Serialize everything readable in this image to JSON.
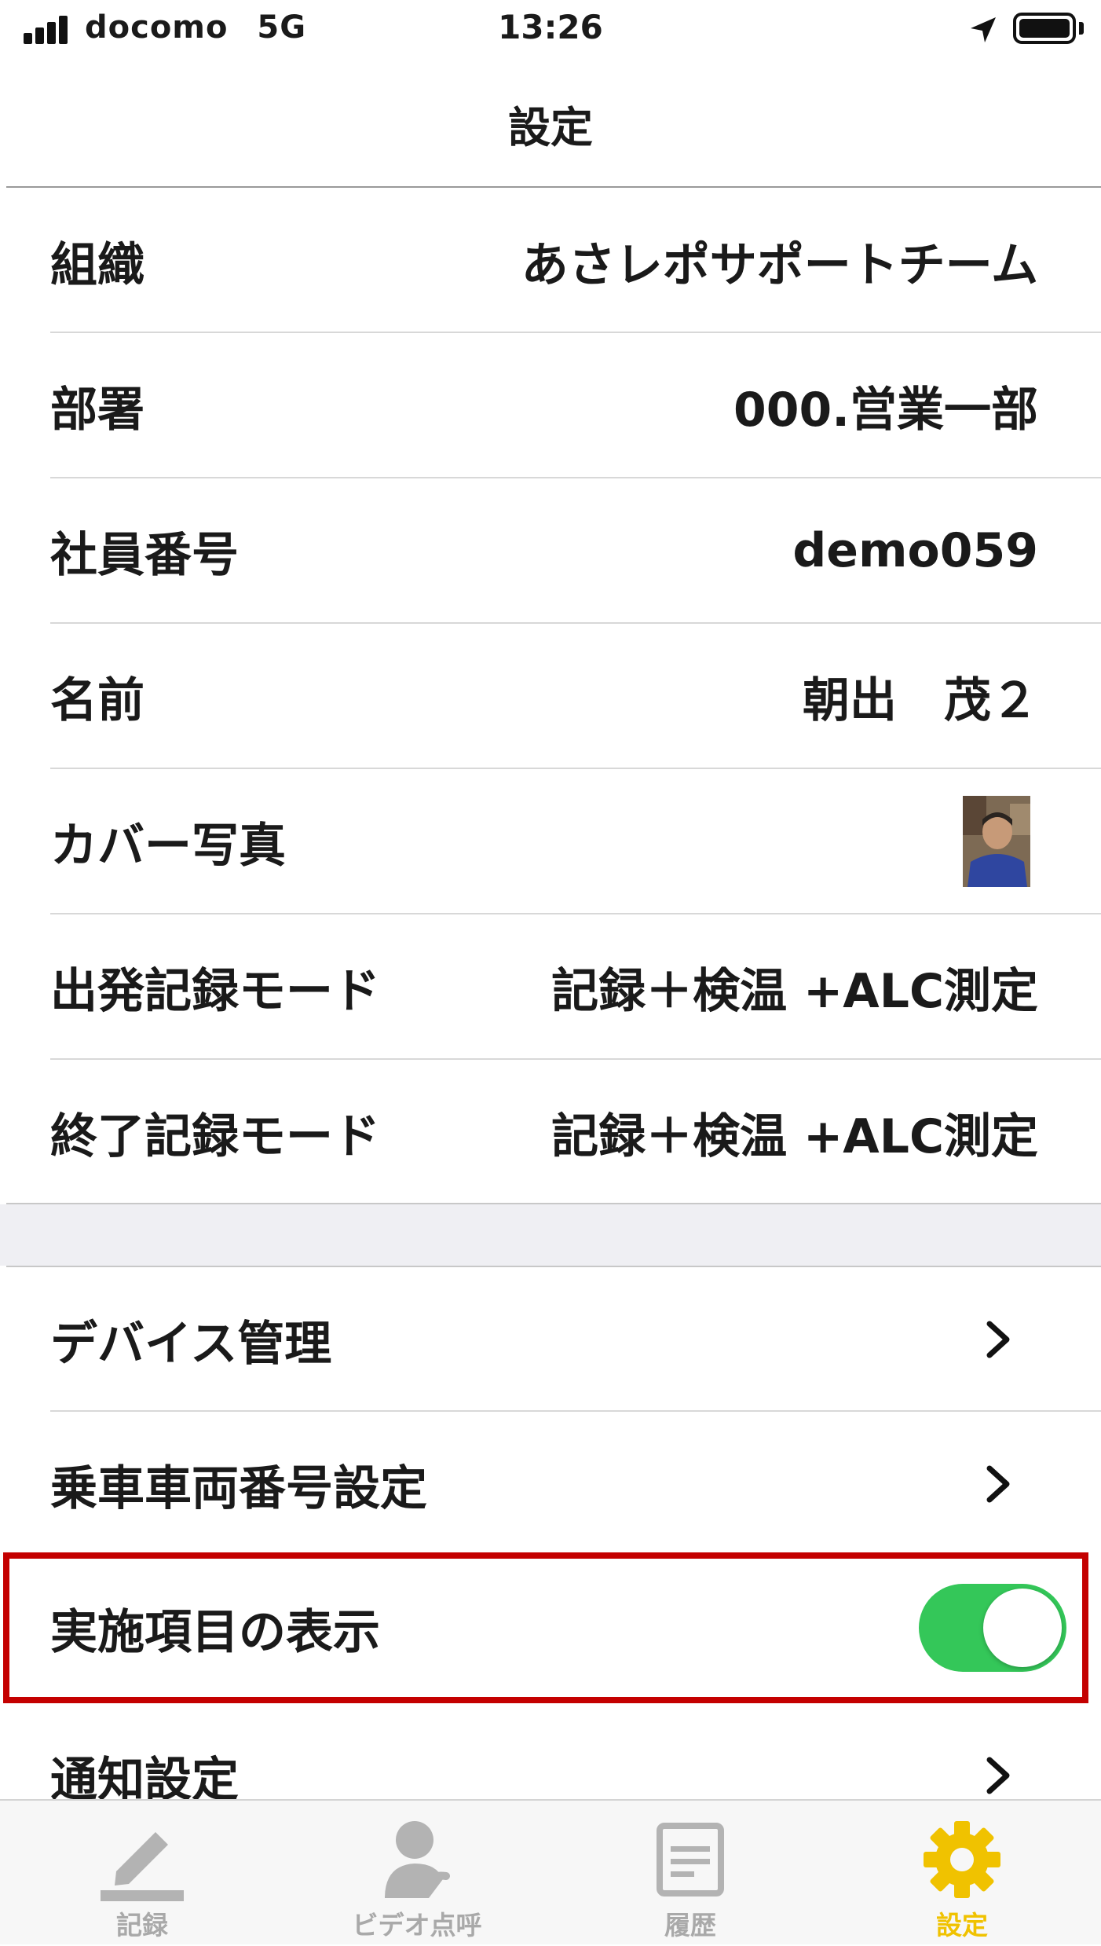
{
  "status_bar": {
    "carrier": "docomo",
    "network": "5G",
    "time": "13:26"
  },
  "nav": {
    "title": "設定"
  },
  "rows": [
    {
      "label": "組織",
      "value": "あさレポサポートチーム"
    },
    {
      "label": "部署",
      "value": "000.営業一部"
    },
    {
      "label": "社員番号",
      "value": "demo059"
    },
    {
      "label": "名前",
      "value": "朝出　茂２"
    },
    {
      "label": "カバー写真",
      "value": ""
    },
    {
      "label": "出発記録モード",
      "value": "記録＋検温 +ALC測定"
    },
    {
      "label": "終了記録モード",
      "value": "記録＋検温 +ALC測定"
    }
  ],
  "menu": [
    {
      "label": "デバイス管理"
    },
    {
      "label": "乗車車両番号設定"
    },
    {
      "label": "実施項目の表示",
      "toggle_on": true
    },
    {
      "label": "通知設定"
    }
  ],
  "tabs": [
    {
      "label": "記録",
      "icon": "pencil-icon",
      "active": false
    },
    {
      "label": "ビデオ点呼",
      "icon": "video-rollcall-icon",
      "active": false
    },
    {
      "label": "履歴",
      "icon": "history-icon",
      "active": false
    },
    {
      "label": "設定",
      "icon": "gear-icon",
      "active": true
    }
  ],
  "colors": {
    "accent": "#f0c200",
    "toggle_on": "#34c759",
    "highlight_border": "#c40000",
    "inactive_tab": "#a9a9a9"
  }
}
